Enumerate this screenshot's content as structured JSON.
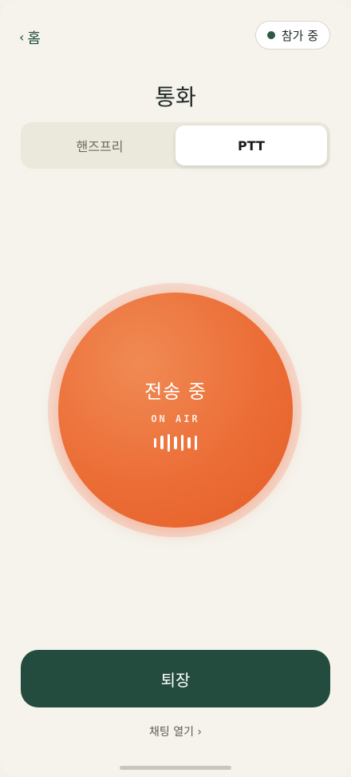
{
  "header": {
    "back_chevron": "‹",
    "back_label": "홈",
    "status_label": "참가 중",
    "status_color": "#2a5a46"
  },
  "page": {
    "title": "통화"
  },
  "mode_tabs": [
    {
      "label": "핸즈프리",
      "active": false
    },
    {
      "label": "PTT",
      "active": true
    }
  ],
  "ptt": {
    "title": "전송 중",
    "subtitle": "ON AIR",
    "color": "#ec6d36",
    "waveform_levels": [
      0.4,
      0.7,
      1.0,
      0.6,
      0.9,
      0.5,
      0.75
    ]
  },
  "footer": {
    "leave_label": "퇴장",
    "chat_label": "채팅 열기 ›",
    "leave_color": "#234b3e"
  }
}
